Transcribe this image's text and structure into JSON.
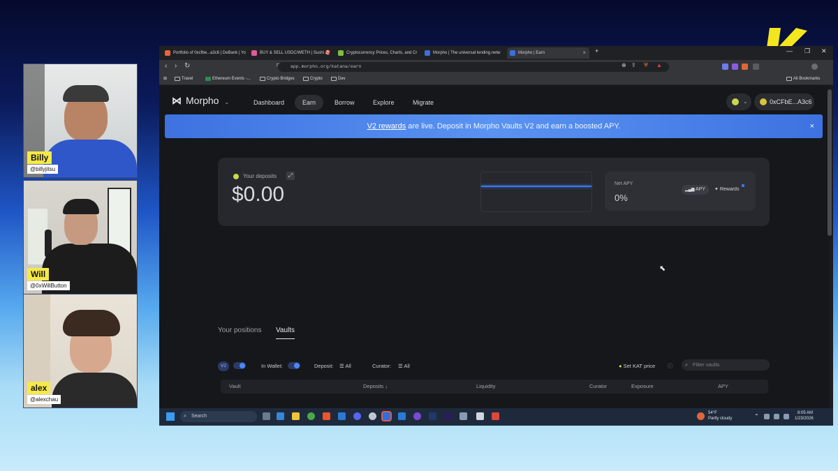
{
  "participants": [
    {
      "name": "Billy",
      "handle": "@billyjitsu"
    },
    {
      "name": "Will",
      "handle": "@0xWillButton"
    },
    {
      "name": "alex",
      "handle": "@alexchau"
    }
  ],
  "browser": {
    "tabs": [
      {
        "label": "Portfolio of 0xcfbe...a3c6 | DeBank | Yo",
        "favicon_color": "#e8663a"
      },
      {
        "label": "BUY & SELL USDC/WETH | Sushi 🍣",
        "favicon_color": "#e05a9a"
      },
      {
        "label": "Cryptocurrency Prices, Charts, and Cr",
        "favicon_color": "#7ac142"
      },
      {
        "label": "Morpho | The universal lending netw",
        "favicon_color": "#3b6fe0"
      },
      {
        "label": "Morpho | Earn",
        "favicon_color": "#3b6fe0"
      }
    ],
    "new_tab": "+",
    "window_controls": [
      "—",
      "❐",
      "✕"
    ],
    "url": "app.morpho.org/katana/earn",
    "bookmarks": [
      "Travel",
      "Ethereum Events -...",
      "Crypto Bridges",
      "Crypto",
      "Dev"
    ],
    "all_bookmarks": "All Bookmarks"
  },
  "app": {
    "brand": "Morpho",
    "nav": [
      "Dashboard",
      "Earn",
      "Borrow",
      "Explore",
      "Migrate"
    ],
    "active_nav": "Earn",
    "wallet_address": "0xCFbE...A3c6",
    "banner": {
      "link": "V2 rewards",
      "text": " are live. Deposit in Morpho Vaults V2 and earn a boosted APY.",
      "close": "×"
    },
    "deposits": {
      "label": "Your deposits",
      "value": "$0.00"
    },
    "net_apy": {
      "label": "Net APY",
      "value": "0%",
      "apy_button": "APY",
      "rewards_button": "Rewards"
    },
    "section_tabs": [
      "Your positions",
      "Vaults"
    ],
    "active_section_tab": "Vaults",
    "filters": {
      "v2_toggle": "V2",
      "in_wallet": "In Wallet:",
      "deposit": "Deposit:",
      "deposit_value": "All",
      "curator": "Curator:",
      "curator_value": "All",
      "set_price": "Set KAT price",
      "search_placeholder": "Filter vaults"
    },
    "table_headers": [
      "Vault",
      "Deposits ↓",
      "Liquidity",
      "Curator",
      "Exposure",
      "APY"
    ]
  },
  "taskbar": {
    "search": "Search",
    "weather_temp": "54°F",
    "weather_desc": "Partly cloudy",
    "time": "8:05 AM",
    "date": "1/23/2026"
  },
  "colors": {
    "accent": "#3d78ec",
    "banner": "#4a82e8",
    "name_tag": "#f5e94a",
    "logo": "#f4e61e"
  }
}
